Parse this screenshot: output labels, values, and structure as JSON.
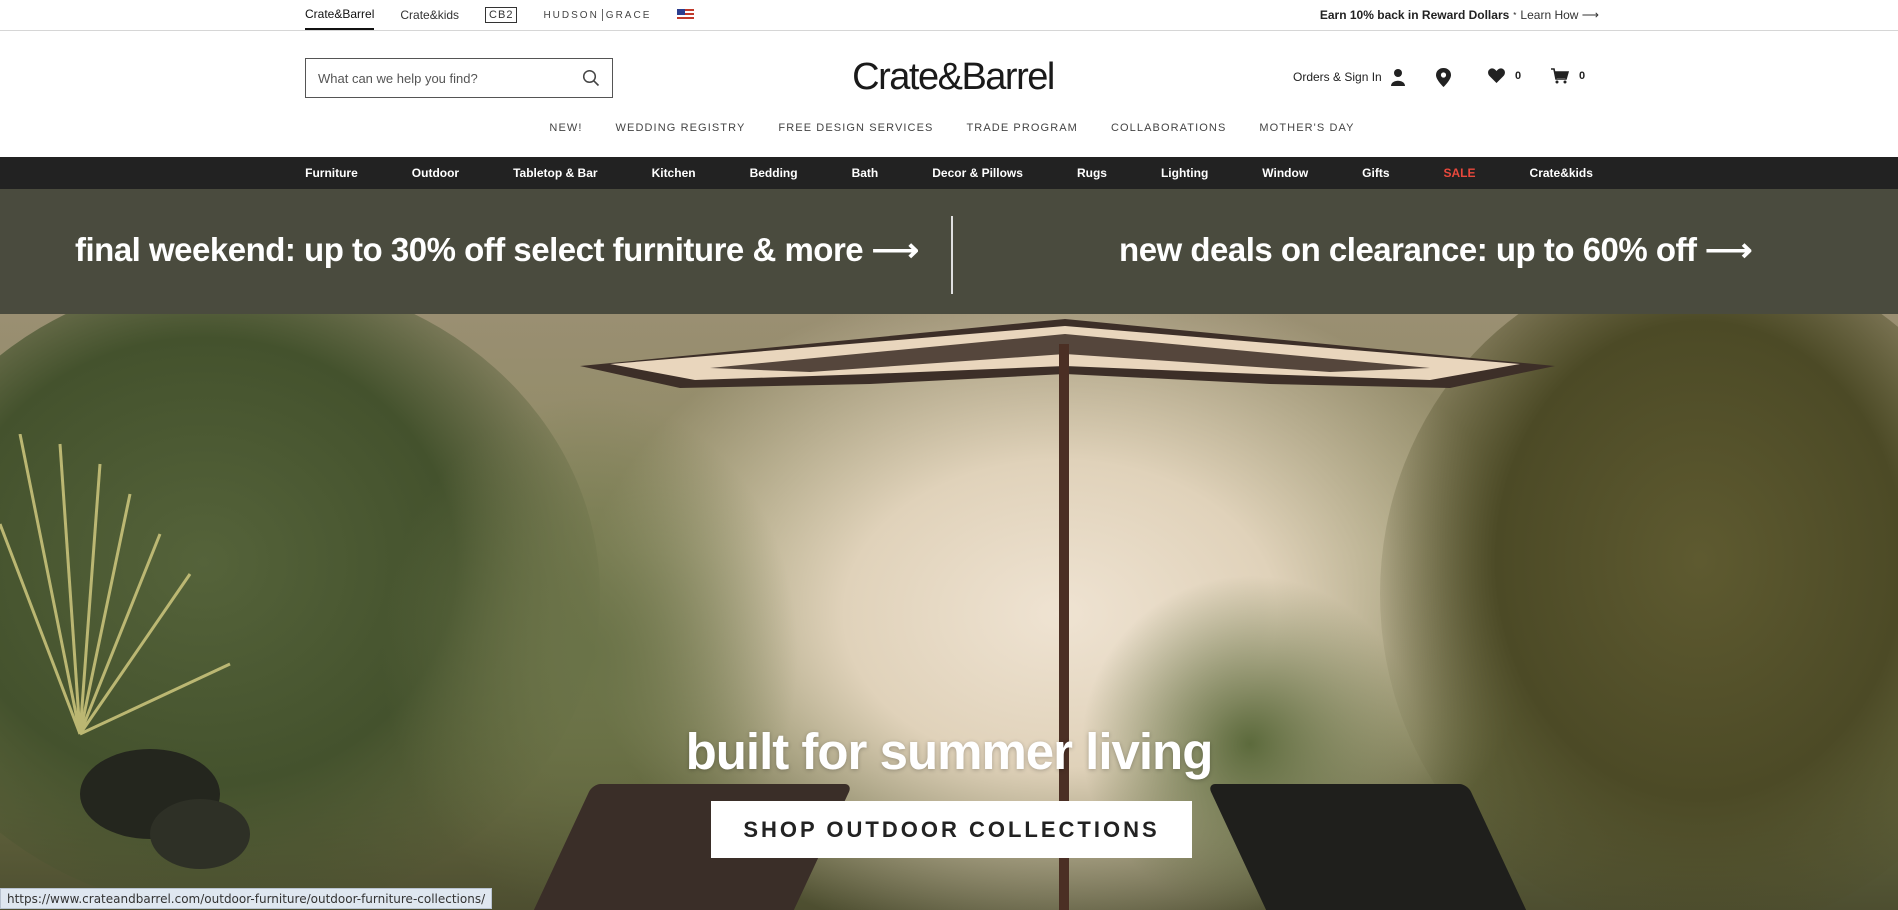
{
  "utility": {
    "brands": [
      "Crate&Barrel",
      "Crate&kids",
      "CB2",
      "HUDSON",
      "GRACE"
    ],
    "reward_text": "Earn 10% back in Reward Dollars",
    "reward_sup": "*",
    "learn_how": "Learn How ⟶"
  },
  "header": {
    "search_placeholder": "What can we help you find?",
    "logo": "Crate&Barrel",
    "orders_signin": "Orders & Sign In",
    "favorites_count": "0",
    "cart_count": "0"
  },
  "subnav": [
    "NEW!",
    "WEDDING REGISTRY",
    "FREE DESIGN SERVICES",
    "TRADE PROGRAM",
    "COLLABORATIONS",
    "MOTHER'S DAY"
  ],
  "categories": [
    "Furniture",
    "Outdoor",
    "Tabletop & Bar",
    "Kitchen",
    "Bedding",
    "Bath",
    "Decor & Pillows",
    "Rugs",
    "Lighting",
    "Window",
    "Gifts",
    "SALE",
    "Crate&kids"
  ],
  "promo": {
    "left": "final weekend: up to 30% off select furniture & more ⟶",
    "right": "new deals on clearance: up to 60% off ⟶"
  },
  "hero": {
    "title": "built for summer living",
    "cta": "SHOP OUTDOOR COLLECTIONS"
  },
  "status_url": "https://www.crateandbarrel.com/outdoor-furniture/outdoor-furniture-collections/",
  "colors": {
    "promo_bg": "#4a4b3e",
    "category_bg": "#222222",
    "sale": "#e8483c"
  },
  "icons": [
    "search-icon",
    "user-icon",
    "location-pin-icon",
    "heart-icon",
    "cart-icon",
    "us-flag-icon"
  ]
}
